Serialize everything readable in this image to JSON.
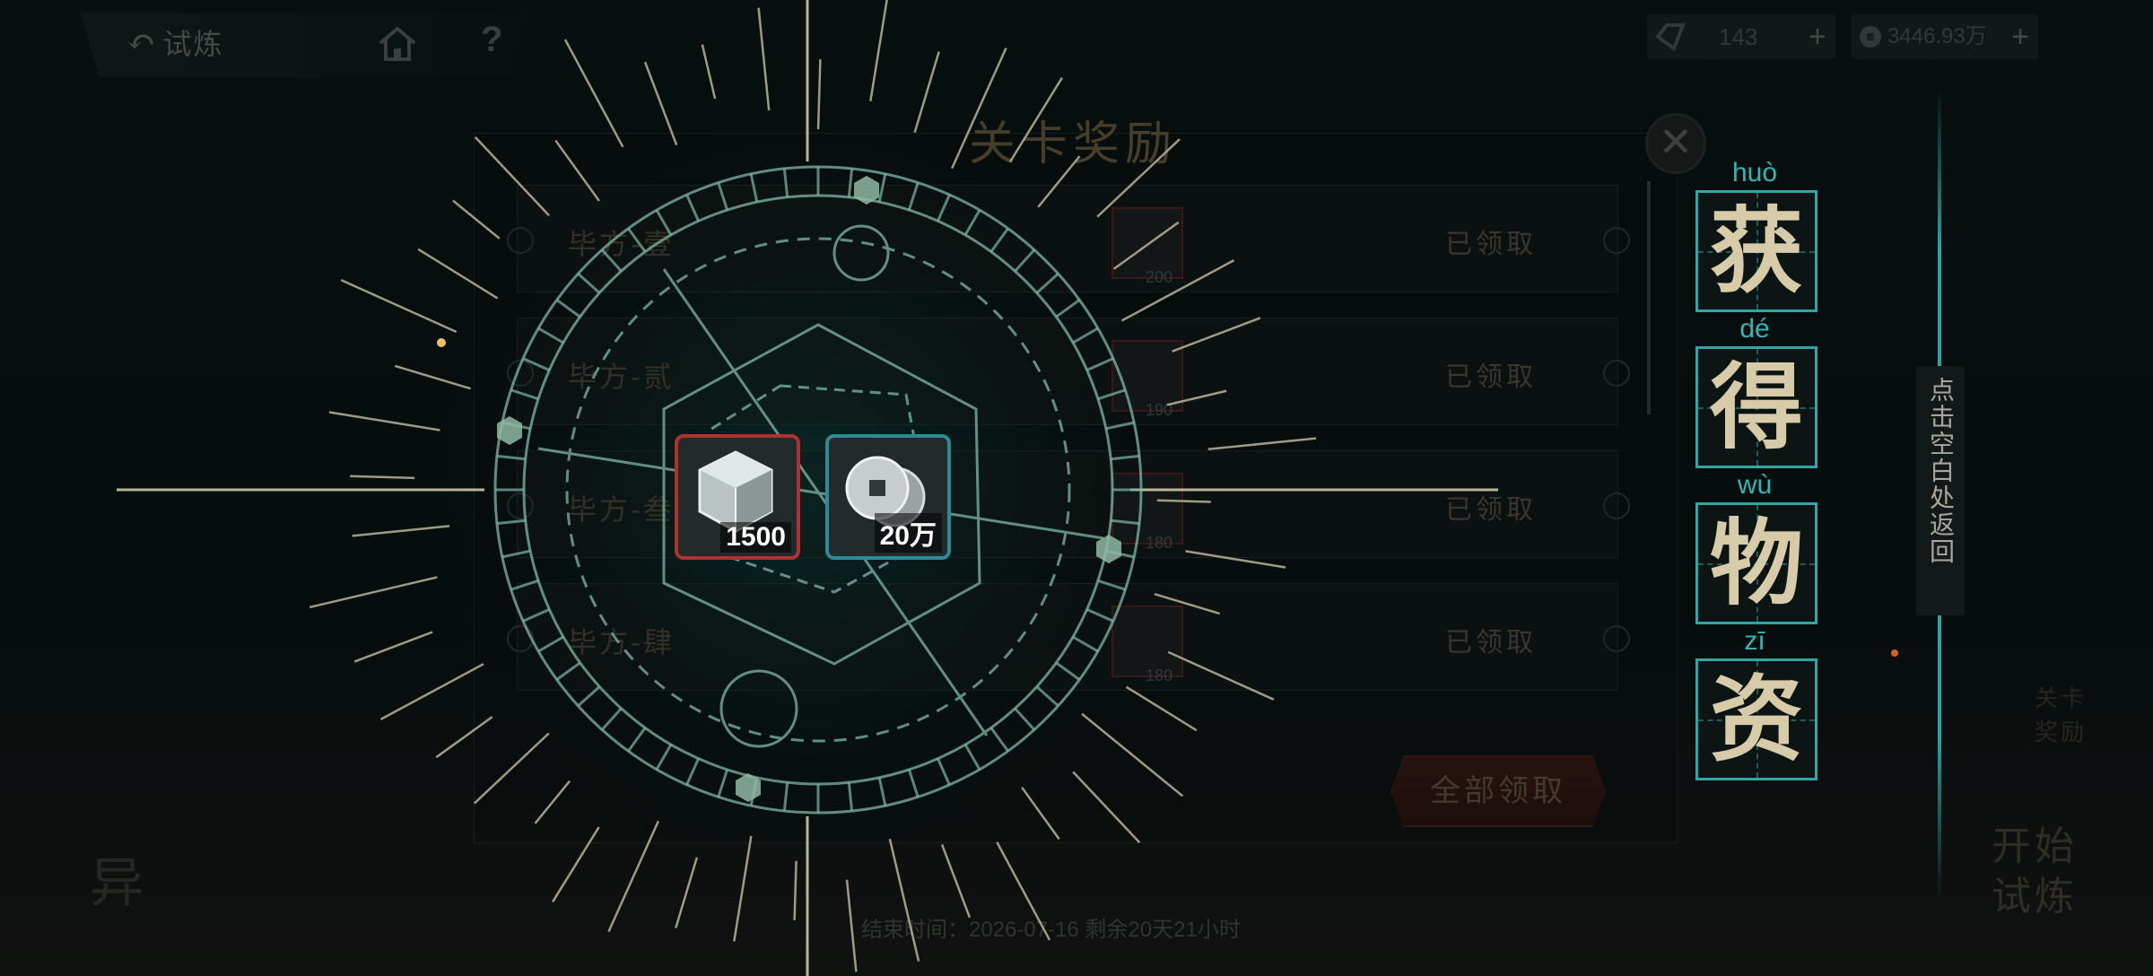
{
  "header": {
    "back_label": "试炼",
    "back_icon": "↶",
    "help_icon": "?",
    "resources": [
      {
        "value": "143",
        "icon": "diamond-icon"
      },
      {
        "value": "3446.93万",
        "icon": "coin-icon"
      }
    ],
    "plus": "+"
  },
  "panel": {
    "title": "关卡奖励",
    "close": "✕",
    "stages": [
      {
        "name": "毕方-壹",
        "status": "已领取",
        "reward_value": "200"
      },
      {
        "name": "毕方-贰",
        "status": "已领取",
        "reward_value": "190"
      },
      {
        "name": "毕方-叁",
        "status": "已领取",
        "reward_value": "180"
      },
      {
        "name": "毕方-肆",
        "status": "已领取",
        "reward_value": "180"
      }
    ],
    "claim_all": "全部领取"
  },
  "obtained": {
    "glyphs": [
      {
        "pinyin": "huò",
        "char": "获"
      },
      {
        "pinyin": "dé",
        "char": "得"
      },
      {
        "pinyin": "wù",
        "char": "物"
      },
      {
        "pinyin": "zī",
        "char": "资"
      }
    ],
    "hint": "点击空白处返回",
    "items": [
      {
        "icon": "crystal-cube-icon",
        "value": "1500",
        "frame": "#b03230"
      },
      {
        "icon": "silver-coins-icon",
        "value": "20万",
        "frame": "#2c8c94"
      }
    ]
  },
  "footer": {
    "time_text": "结束时间：2026-07-16  剩余20天21小时",
    "start_button": "开始试炼",
    "stage_reward_button": "关卡奖励",
    "left_glyph": "异"
  },
  "colors": {
    "accent": "#2da8a6",
    "glyph": "#d8cbaa",
    "red_frame": "#b03230"
  }
}
